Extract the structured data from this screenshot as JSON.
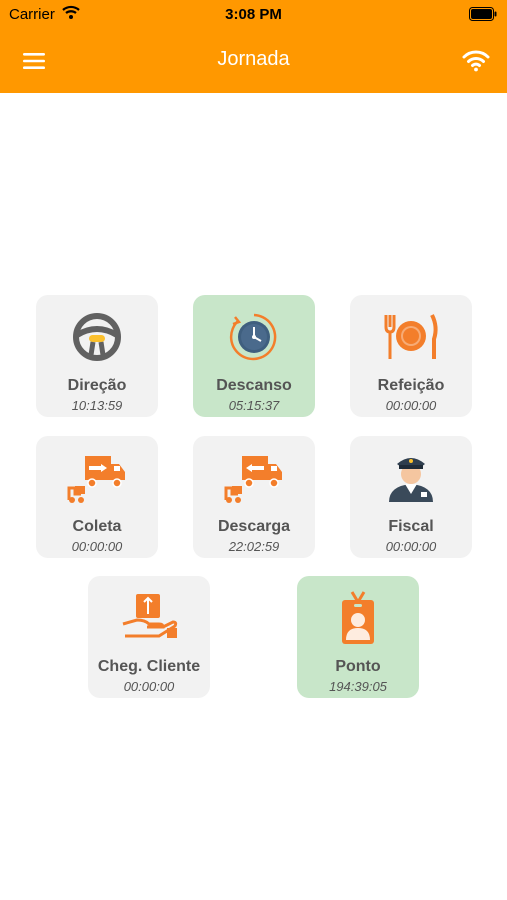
{
  "status_bar": {
    "carrier": "Carrier",
    "time": "3:08 PM"
  },
  "header": {
    "title": "Jornada"
  },
  "colors": {
    "accent": "#ff9800",
    "tile_bg": "#f2f2f2",
    "tile_active_bg": "#c8e6c9",
    "icon_orange": "#f37e2b"
  },
  "tiles": [
    {
      "label": "Direção",
      "time": "10:13:59",
      "icon": "steering-wheel-icon",
      "active": false
    },
    {
      "label": "Descanso",
      "time": "05:15:37",
      "icon": "clock-icon",
      "active": true
    },
    {
      "label": "Refeição",
      "time": "00:00:00",
      "icon": "fork-plate-knife-icon",
      "active": false
    },
    {
      "label": "Coleta",
      "time": "00:00:00",
      "icon": "truck-loading-icon",
      "active": false
    },
    {
      "label": "Descarga",
      "time": "22:02:59",
      "icon": "truck-unloading-icon",
      "active": false
    },
    {
      "label": "Fiscal",
      "time": "00:00:00",
      "icon": "police-officer-icon",
      "active": false
    },
    {
      "label": "Cheg. Cliente",
      "time": "00:00:00",
      "icon": "hand-box-icon",
      "active": false
    },
    {
      "label": "Ponto",
      "time": "194:39:05",
      "icon": "id-badge-icon",
      "active": true
    }
  ]
}
